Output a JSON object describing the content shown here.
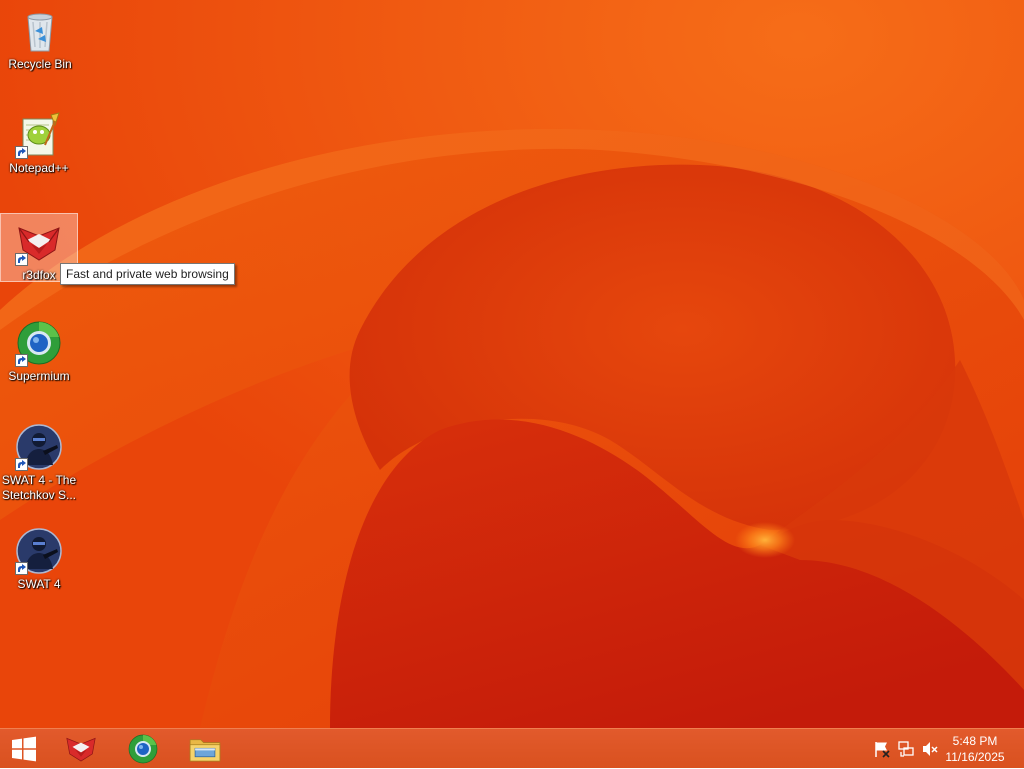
{
  "desktop": {
    "icons": [
      {
        "label": "Recycle Bin",
        "icon": "recycle-bin-icon",
        "shortcut": false
      },
      {
        "label": "Notepad++",
        "icon": "notepad-plus-plus-icon",
        "shortcut": true
      },
      {
        "label": "r3dfox",
        "icon": "r3dfox-icon",
        "shortcut": true,
        "selected": true
      },
      {
        "label": "Supermium",
        "icon": "supermium-icon",
        "shortcut": true
      },
      {
        "label": "SWAT 4 - The Stetchkov S...",
        "icon": "swat4-icon",
        "shortcut": true
      },
      {
        "label": "SWAT 4",
        "icon": "swat4-icon",
        "shortcut": true
      }
    ],
    "tooltip": "Fast and private web browsing"
  },
  "taskbar": {
    "start_icon": "windows-logo-icon",
    "pinned": [
      {
        "icon": "r3dfox-icon"
      },
      {
        "icon": "supermium-icon"
      },
      {
        "icon": "file-explorer-icon"
      }
    ],
    "tray": [
      {
        "icon": "action-center-flag-icon"
      },
      {
        "icon": "network-icon"
      },
      {
        "icon": "volume-muted-icon"
      }
    ],
    "clock": {
      "time": "5:48 PM",
      "date": "11/16/2025"
    }
  },
  "colors": {
    "wallpaper_base": "#e94a09",
    "wallpaper_deep": "#c81d0a",
    "taskbar": "#dc5522",
    "accent_orange": "#ff8a1c"
  }
}
